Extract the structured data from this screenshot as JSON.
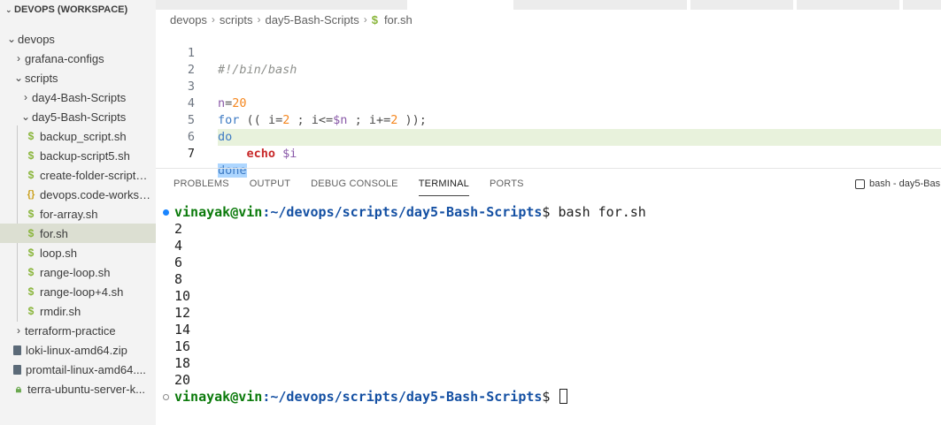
{
  "sidebar": {
    "workspace_title": "DEVOPS (WORKSPACE)",
    "items": [
      {
        "label": "devops",
        "type": "folder-open"
      },
      {
        "label": "grafana-configs",
        "type": "folder-closed"
      },
      {
        "label": "scripts",
        "type": "folder-open"
      },
      {
        "label": "day4-Bash-Scripts",
        "type": "folder-closed"
      },
      {
        "label": "day5-Bash-Scripts",
        "type": "folder-open"
      },
      {
        "label": "backup_script.sh",
        "type": "shell-file"
      },
      {
        "label": "backup-script5.sh",
        "type": "shell-file"
      },
      {
        "label": "create-folder-script…",
        "type": "shell-file"
      },
      {
        "label": "devops.code-works…",
        "type": "workspace-file"
      },
      {
        "label": "for-array.sh",
        "type": "shell-file"
      },
      {
        "label": "for.sh",
        "type": "shell-file",
        "selected": true
      },
      {
        "label": "loop.sh",
        "type": "shell-file"
      },
      {
        "label": "range-loop.sh",
        "type": "shell-file"
      },
      {
        "label": "range-loop+4.sh",
        "type": "shell-file"
      },
      {
        "label": "rmdir.sh",
        "type": "shell-file"
      },
      {
        "label": "terraform-practice",
        "type": "folder-closed"
      },
      {
        "label": "loki-linux-amd64.zip",
        "type": "zip-file"
      },
      {
        "label": "promtail-linux-amd64....",
        "type": "zip-file"
      },
      {
        "label": "terra-ubuntu-server-k...",
        "type": "key-file"
      }
    ]
  },
  "breadcrumb": {
    "parts": [
      "devops",
      "scripts",
      "day5-Bash-Scripts"
    ],
    "file": "for.sh",
    "file_icon": "$"
  },
  "editor": {
    "active_line": 7,
    "lines": [
      {
        "num": "1",
        "text": "#!/bin/bash"
      },
      {
        "num": "2",
        "text": ""
      },
      {
        "num": "3",
        "text": "n=20"
      },
      {
        "num": "4",
        "text": "for (( i=2 ; i<=$n ; i+=2 ));"
      },
      {
        "num": "5",
        "text": "do"
      },
      {
        "num": "6",
        "text": "    echo $i"
      },
      {
        "num": "7",
        "text": "done"
      }
    ]
  },
  "panel": {
    "tabs": [
      "PROBLEMS",
      "OUTPUT",
      "DEBUG CONSOLE",
      "TERMINAL",
      "PORTS"
    ],
    "active_tab": "TERMINAL",
    "terminal_name": "bash - day5-Bas"
  },
  "terminal": {
    "user": "vinayak@vin",
    "path": ":~/devops/scripts/day5-Bash-Scripts",
    "prompt_symbol": "$",
    "command": " bash for.sh",
    "output": [
      "2",
      "4",
      "6",
      "8",
      "10",
      "12",
      "14",
      "16",
      "18",
      "20"
    ]
  },
  "colors": {
    "selection_bg": "#dcdfd2",
    "current_line_bg": "#e8f2dc",
    "prompt_user": "#0b7a0b",
    "prompt_path": "#1450a3",
    "shell_icon": "#89b53a"
  }
}
